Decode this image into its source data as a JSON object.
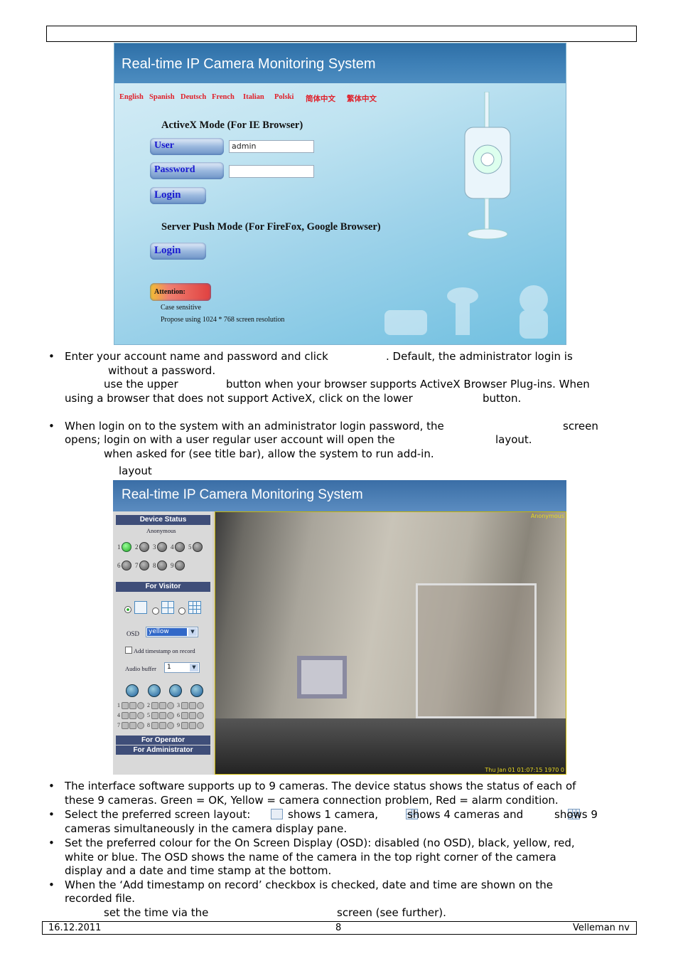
{
  "app_title": "Real-time IP Camera Monitoring System",
  "login_screen": {
    "languages": [
      "English",
      "Spanish",
      "Deutsch",
      "French",
      "Italian",
      "Polski",
      "简体中文",
      "繁体中文"
    ],
    "activex_heading": "ActiveX Mode (For IE Browser)",
    "user_label": "User",
    "user_value": "admin",
    "password_label": "Password",
    "password_value": "",
    "login_label": "Login",
    "server_push_heading": "Server Push Mode (For FireFox, Google Browser)",
    "server_push_login_label": "Login",
    "attention_label": "Attention:",
    "note1": "Case sensitive",
    "note2": "Propose using 1024 * 768 screen resolution"
  },
  "text1": {
    "l1a": "Enter your account name and password and click",
    "l1b": ". Default, the administrator login is",
    "l2": "without a password.",
    "l3a": "use the upper",
    "l3b": "button when your browser supports ActiveX Browser Plug-ins. When",
    "l4a": "using a browser that does not support ActiveX, click on the lower",
    "l4b": "button.",
    "l5a": "When login on to the system with an administrator login password, the",
    "l5b": "screen",
    "l6a": "opens; login on with a user regular user account will open the",
    "l6b": "layout.",
    "l7": "when asked for (see title bar), allow the system to run add-in.",
    "l8": "layout"
  },
  "visitor_screen": {
    "device_status": "Device Status",
    "user": "Anonymous",
    "cameras": [
      {
        "n": "1",
        "status": "ok"
      },
      {
        "n": "2",
        "status": "off"
      },
      {
        "n": "3",
        "status": "off"
      },
      {
        "n": "4",
        "status": "off"
      },
      {
        "n": "5",
        "status": "off"
      },
      {
        "n": "6",
        "status": "off"
      },
      {
        "n": "7",
        "status": "off"
      },
      {
        "n": "8",
        "status": "off"
      },
      {
        "n": "9",
        "status": "off"
      }
    ],
    "for_visitor": "For Visitor",
    "layout_selected": "1 camera",
    "osd_label": "OSD",
    "osd_value": "yellow",
    "timestamp_label": "Add timestamp on record",
    "timestamp_checked": false,
    "audio_buffer_label": "Audio buffer",
    "audio_buffer_value": "1",
    "for_operator": "For Operator",
    "for_administrator": "For Administrator",
    "osd_camera_name": "Anonymous",
    "osd_timestamp": "Thu Jan 01 01:07:15 1970 0",
    "colors": {
      "ok": "#2aa02a",
      "off": "#666666",
      "osd": "#e8d820"
    }
  },
  "text2": {
    "b1a": "The interface software supports up to 9 cameras. The device status shows the status of each of",
    "b1b": "these 9 cameras. Green = OK, Yellow = camera connection problem, Red = alarm condition.",
    "b2a": "Select the preferred screen layout:",
    "b2b": "shows 1 camera,",
    "b2c": "shows 4 cameras and",
    "b2d": "shows 9",
    "b2e": "cameras simultaneously in the camera display pane.",
    "b3a": "Set the preferred colour for the On Screen Display (OSD): disabled (no OSD), black, yellow, red,",
    "b3b": "white or blue. The OSD shows the name of the camera in the top right corner of the camera",
    "b3c": "display and a date and time stamp at the bottom.",
    "b4a": "When the ‘Add timestamp on record’ checkbox is checked, date and time are shown on the",
    "b4b": "recorded file.",
    "b5a": "set the time via the",
    "b5b": "screen (see further)."
  },
  "footer": {
    "date": "16.12.2011",
    "page": "8",
    "company": "Velleman nv"
  }
}
